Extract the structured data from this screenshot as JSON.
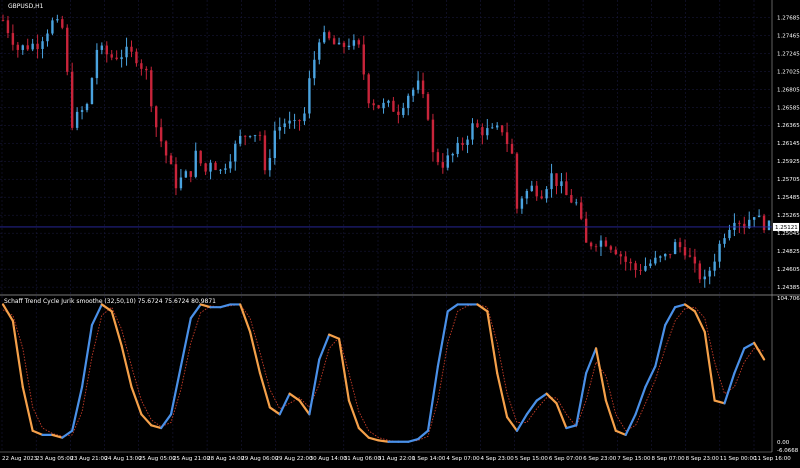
{
  "window": {
    "symbol_title": "GBPUSD,H1",
    "indicator_title": "Schaff Trend Cycle Jurik smoothe (32,50,10) 75.6724 75.6724 80.9871",
    "current_price": "1.25121"
  },
  "colors": {
    "background": "#000000",
    "grid": "#1c1c44",
    "axis": "#a0a0a0",
    "bull_candle": "#4aa3df",
    "bear_candle": "#c8243a",
    "price_line": "#2a2aa8",
    "stc_up": "#4a90e8",
    "stc_down": "#f5a04a",
    "signal": "#c83c28"
  },
  "chart_data": [
    {
      "type": "candlestick",
      "title": "GBPUSD,H1",
      "ylim": [
        1.2435,
        1.2775
      ],
      "y_ticks": [
        "1.27685",
        "1.27465",
        "1.27245",
        "1.27025",
        "1.26805",
        "1.26585",
        "1.26365",
        "1.26145",
        "1.25925",
        "1.25705",
        "1.25485",
        "1.25265",
        "1.25045",
        "1.24825",
        "1.24605",
        "1.24385"
      ],
      "current_price": 1.25121,
      "close_path": [
        [
          0,
          1.2765
        ],
        [
          3,
          1.273
        ],
        [
          7,
          1.2737
        ],
        [
          10,
          1.2762
        ],
        [
          12,
          1.2755
        ],
        [
          14,
          1.264
        ],
        [
          17,
          1.266
        ],
        [
          19,
          1.273
        ],
        [
          22,
          1.272
        ],
        [
          25,
          1.2725
        ],
        [
          27,
          1.272
        ],
        [
          29,
          1.27
        ],
        [
          31,
          1.2635
        ],
        [
          33,
          1.26
        ],
        [
          35,
          1.2565
        ],
        [
          36,
          1.257
        ],
        [
          38,
          1.258
        ],
        [
          39,
          1.26
        ],
        [
          41,
          1.258
        ],
        [
          42,
          1.2595
        ],
        [
          44,
          1.258
        ],
        [
          46,
          1.26
        ],
        [
          48,
          1.262
        ],
        [
          50,
          1.263
        ],
        [
          52,
          1.2625
        ],
        [
          53,
          1.2575
        ],
        [
          55,
          1.263
        ],
        [
          57,
          1.264
        ],
        [
          59,
          1.2635
        ],
        [
          61,
          1.265
        ],
        [
          62,
          1.269
        ],
        [
          64,
          1.2745
        ],
        [
          66,
          1.274
        ],
        [
          68,
          1.273
        ],
        [
          70,
          1.2738
        ],
        [
          72,
          1.273
        ],
        [
          74,
          1.267
        ],
        [
          76,
          1.266
        ],
        [
          78,
          1.266
        ],
        [
          80,
          1.2655
        ],
        [
          82,
          1.2675
        ],
        [
          84,
          1.2685
        ],
        [
          86,
          1.265
        ],
        [
          87,
          1.26
        ],
        [
          89,
          1.259
        ],
        [
          91,
          1.26
        ],
        [
          93,
          1.2615
        ],
        [
          95,
          1.2635
        ],
        [
          97,
          1.263
        ],
        [
          99,
          1.2628
        ],
        [
          101,
          1.2632
        ],
        [
          103,
          1.26
        ],
        [
          104,
          1.2535
        ],
        [
          105,
          1.255
        ],
        [
          107,
          1.256
        ],
        [
          109,
          1.2555
        ],
        [
          111,
          1.2575
        ],
        [
          113,
          1.256
        ],
        [
          114,
          1.255
        ],
        [
          116,
          1.254
        ],
        [
          118,
          1.249
        ],
        [
          120,
          1.2495
        ],
        [
          122,
          1.2495
        ],
        [
          124,
          1.2485
        ],
        [
          126,
          1.247
        ],
        [
          128,
          1.246
        ],
        [
          130,
          1.2465
        ],
        [
          132,
          1.247
        ],
        [
          134,
          1.2475
        ],
        [
          136,
          1.249
        ],
        [
          138,
          1.2485
        ],
        [
          140,
          1.246
        ],
        [
          142,
          1.2445
        ],
        [
          144,
          1.2475
        ],
        [
          146,
          1.2505
        ],
        [
          148,
          1.2525
        ],
        [
          150,
          1.2515
        ],
        [
          152,
          1.253
        ],
        [
          153,
          1.252
        ],
        [
          155,
          1.2512
        ]
      ],
      "x_tick_labels": [
        "22 Aug 2023",
        "23 Aug 05:00",
        "23 Aug 21:00",
        "24 Aug 13:00",
        "25 Aug 05:00",
        "25 Aug 21:00",
        "28 Aug 14:00",
        "29 Aug 06:00",
        "29 Aug 22:00",
        "30 Aug 14:00",
        "31 Aug 06:00",
        "31 Aug 22:00",
        "1 Sep 14:00",
        "4 Sep 07:00",
        "4 Sep 23:00",
        "5 Sep 15:00",
        "6 Sep 07:00",
        "6 Sep 23:00",
        "7 Sep 15:00",
        "8 Sep 07:00",
        "8 Sep 23:00",
        "11 Sep 00:00",
        "11 Sep 16:00"
      ]
    },
    {
      "type": "line",
      "title": "Schaff Trend Cycle Jurik smoothe (32,50,10) 75.6724 75.6724 80.9871",
      "ylim": [
        -6.0,
        104.7
      ],
      "y_ticks": [
        "104.7067",
        "0.00",
        "-6.0668"
      ],
      "series": [
        {
          "name": "STC",
          "style": "solid-two-color",
          "x": [
            0,
            2,
            4,
            6,
            8,
            10,
            12,
            14,
            16,
            18,
            20,
            22,
            24,
            26,
            28,
            30,
            32,
            34,
            36,
            38,
            40,
            42,
            44,
            46,
            48,
            50,
            52,
            54,
            56,
            58,
            60,
            62,
            64,
            66,
            68,
            70,
            72,
            74,
            76,
            78,
            80,
            82,
            84,
            86,
            88,
            90,
            92,
            94,
            96,
            98,
            100,
            102,
            104,
            106,
            108,
            110,
            112,
            114,
            116,
            118,
            120,
            122,
            124,
            126,
            128,
            130,
            132,
            134,
            136,
            138,
            140,
            142,
            144,
            146,
            148,
            150,
            152,
            154
          ],
          "values": [
            100,
            88,
            40,
            8,
            5,
            5,
            3,
            8,
            40,
            85,
            100,
            95,
            70,
            40,
            20,
            12,
            10,
            20,
            55,
            90,
            100,
            98,
            98,
            100,
            100,
            80,
            50,
            25,
            20,
            35,
            30,
            20,
            60,
            78,
            75,
            30,
            10,
            3,
            1,
            0,
            0,
            0,
            2,
            8,
            55,
            95,
            100,
            100,
            100,
            95,
            50,
            18,
            8,
            20,
            30,
            35,
            28,
            10,
            12,
            50,
            68,
            30,
            8,
            5,
            20,
            40,
            55,
            85,
            98,
            100,
            95,
            80,
            30,
            28,
            50,
            68,
            72,
            60
          ]
        },
        {
          "name": "Signal",
          "style": "dotted",
          "x": [
            0,
            2,
            4,
            6,
            8,
            10,
            12,
            14,
            16,
            18,
            20,
            22,
            24,
            26,
            28,
            30,
            32,
            34,
            36,
            38,
            40,
            42,
            44,
            46,
            48,
            50,
            52,
            54,
            56,
            58,
            60,
            62,
            64,
            66,
            68,
            70,
            72,
            74,
            76,
            78,
            80,
            82,
            84,
            86,
            88,
            90,
            92,
            94,
            96,
            98,
            100,
            102,
            104,
            106,
            108,
            110,
            112,
            114,
            116,
            118,
            120,
            122,
            124,
            126,
            128,
            130,
            132,
            134,
            136,
            138,
            140,
            142,
            144,
            146,
            148,
            150,
            152,
            154
          ],
          "values": [
            96,
            92,
            68,
            25,
            10,
            6,
            4,
            5,
            22,
            62,
            92,
            98,
            82,
            55,
            30,
            16,
            11,
            14,
            38,
            72,
            94,
            99,
            98,
            99,
            100,
            90,
            65,
            38,
            24,
            28,
            32,
            25,
            42,
            68,
            76,
            50,
            22,
            8,
            3,
            1,
            0,
            0,
            1,
            4,
            30,
            72,
            95,
            99,
            100,
            98,
            72,
            35,
            14,
            14,
            24,
            32,
            32,
            20,
            11,
            30,
            58,
            48,
            20,
            8,
            12,
            28,
            45,
            68,
            88,
            97,
            98,
            90,
            58,
            35,
            40,
            58,
            68,
            66
          ]
        }
      ]
    }
  ]
}
